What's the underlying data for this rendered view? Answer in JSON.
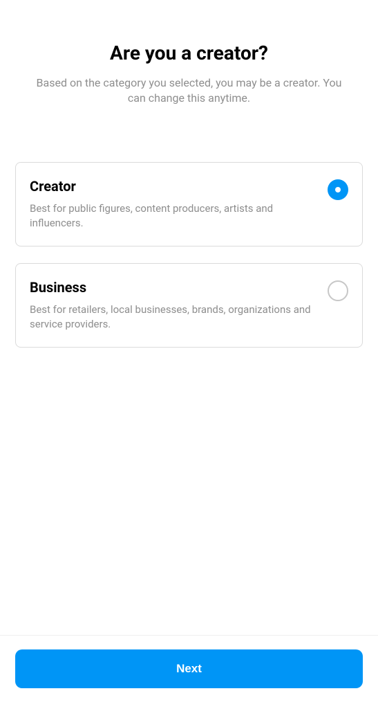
{
  "header": {
    "title": "Are you a creator?",
    "subtitle": "Based on the category you selected, you may be a creator. You can change this anytime."
  },
  "options": [
    {
      "title": "Creator",
      "description": "Best for public figures, content producers, artists and influencers.",
      "selected": true
    },
    {
      "title": "Business",
      "description": "Best for retailers, local businesses, brands, organizations and service providers.",
      "selected": false
    }
  ],
  "footer": {
    "next_label": "Next"
  }
}
